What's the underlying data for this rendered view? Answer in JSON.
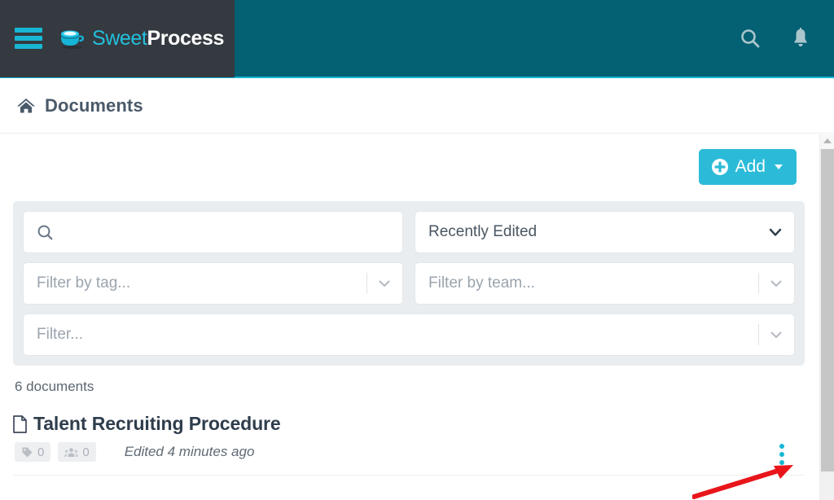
{
  "navbar": {
    "menu_toggle": "hamburger-menu",
    "brand": {
      "sweet": "Sweet",
      "process": "Process"
    },
    "search_icon": "search-icon",
    "notifications_icon": "bell-icon",
    "bg_color": "#046073",
    "brand_bg_color": "#343a40",
    "accent_color": "#17b7d4"
  },
  "breadcrumb": {
    "home_icon": "home-icon",
    "label": "Documents"
  },
  "toolbar": {
    "add_label": "Add",
    "add_icon": "plus-circle-icon",
    "add_caret": "caret-down-icon",
    "add_color": "#2bbbd8"
  },
  "filters": {
    "search": {
      "value": "",
      "placeholder": "",
      "icon": "search-icon"
    },
    "sort": {
      "value": "Recently Edited",
      "icon": "chevron-down-icon"
    },
    "tag": {
      "value": "",
      "placeholder": "Filter by tag...",
      "icon": "chevron-down-icon"
    },
    "team": {
      "value": "",
      "placeholder": "Filter by team...",
      "icon": "chevron-down-icon"
    },
    "general": {
      "value": "",
      "placeholder": "Filter...",
      "icon": "chevron-down-icon"
    }
  },
  "list": {
    "count_label": "6 documents",
    "documents": [
      {
        "title": "Talent Recruiting Procedure",
        "file_icon": "file-icon",
        "tag_count": "0",
        "team_count": "0",
        "edited": "Edited 4 minutes ago",
        "menu_icon": "kebab-menu-icon"
      }
    ]
  },
  "scrollbar": {
    "up_arrow": "scroll-up-arrow",
    "thumb": "scrollbar-thumb"
  },
  "annotation": {
    "arrow": "red-pointer-arrow",
    "color": "#e8151b"
  }
}
